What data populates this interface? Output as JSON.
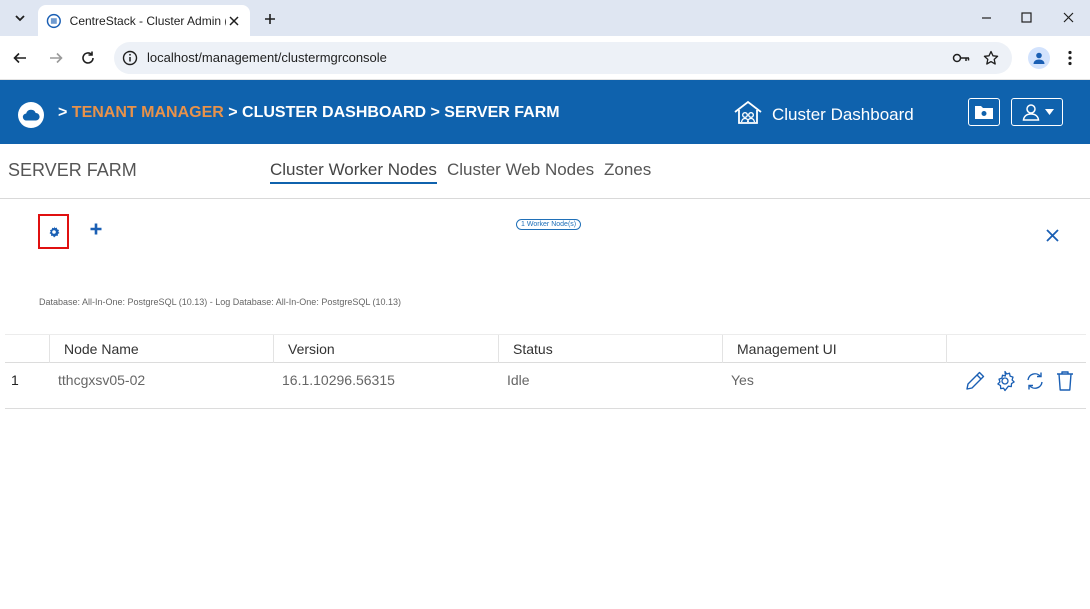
{
  "browser": {
    "tab_title": "CentreStack - Cluster Admin (jm",
    "url": "localhost/management/clustermgrconsole"
  },
  "app": {
    "breadcrumb": {
      "sep": ">",
      "items": [
        "TENANT MANAGER",
        "CLUSTER DASHBOARD",
        "SERVER FARM"
      ],
      "active_index": 0
    },
    "cluster_dashboard_label": "Cluster Dashboard",
    "brand_color": "#0f62ad",
    "accent_color": "#e8924a"
  },
  "page": {
    "title": "SERVER FARM",
    "tabs": [
      {
        "label": "Cluster Worker Nodes",
        "active": true
      },
      {
        "label": "Cluster Web Nodes",
        "active": false
      },
      {
        "label": "Zones",
        "active": false
      }
    ],
    "node_count_badge": "1 Worker Node(s)",
    "db_info": "Database: All-In-One: PostgreSQL (10.13) - Log Database: All-In-One: PostgreSQL (10.13)"
  },
  "table": {
    "columns": [
      "Node Name",
      "Version",
      "Status",
      "Management UI"
    ],
    "rows": [
      {
        "index": "1",
        "node_name": "tthcgxsv05-02",
        "version": "16.1.10296.56315",
        "status": "Idle",
        "management_ui": "Yes"
      }
    ]
  },
  "icons": {
    "tab_list": "chevron-down-icon",
    "favicon": "centrestack-favicon-icon",
    "settings_tool": "gear-icon",
    "add_tool": "plus-icon",
    "close": "close-icon",
    "row_actions": [
      "pencil-icon",
      "gear-icon",
      "refresh-icon",
      "trash-icon"
    ]
  }
}
